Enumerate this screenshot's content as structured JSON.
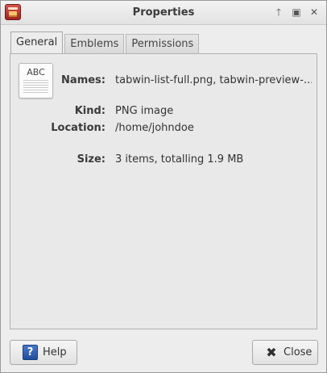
{
  "window": {
    "title": "Properties",
    "controls": {
      "up_glyph": "🡑",
      "maximize_glyph": "▣",
      "close_glyph": "✕"
    }
  },
  "tabs": [
    {
      "label": "General",
      "active": true
    },
    {
      "label": "Emblems",
      "active": false
    },
    {
      "label": "Permissions",
      "active": false
    }
  ],
  "file_icon": {
    "text": "ABC",
    "icon": "text-document-icon"
  },
  "properties": {
    "names_label": "Names:",
    "names_value": "tabwin-list-full.png, tabwin-preview-...",
    "kind_label": "Kind:",
    "kind_value": "PNG image",
    "location_label": "Location:",
    "location_value": "/home/johndoe",
    "size_label": "Size:",
    "size_value": "3 items, totalling 1.9 MB"
  },
  "buttons": {
    "help_label": "Help",
    "help_glyph": "?",
    "close_label": "Close",
    "close_glyph": "✖"
  }
}
